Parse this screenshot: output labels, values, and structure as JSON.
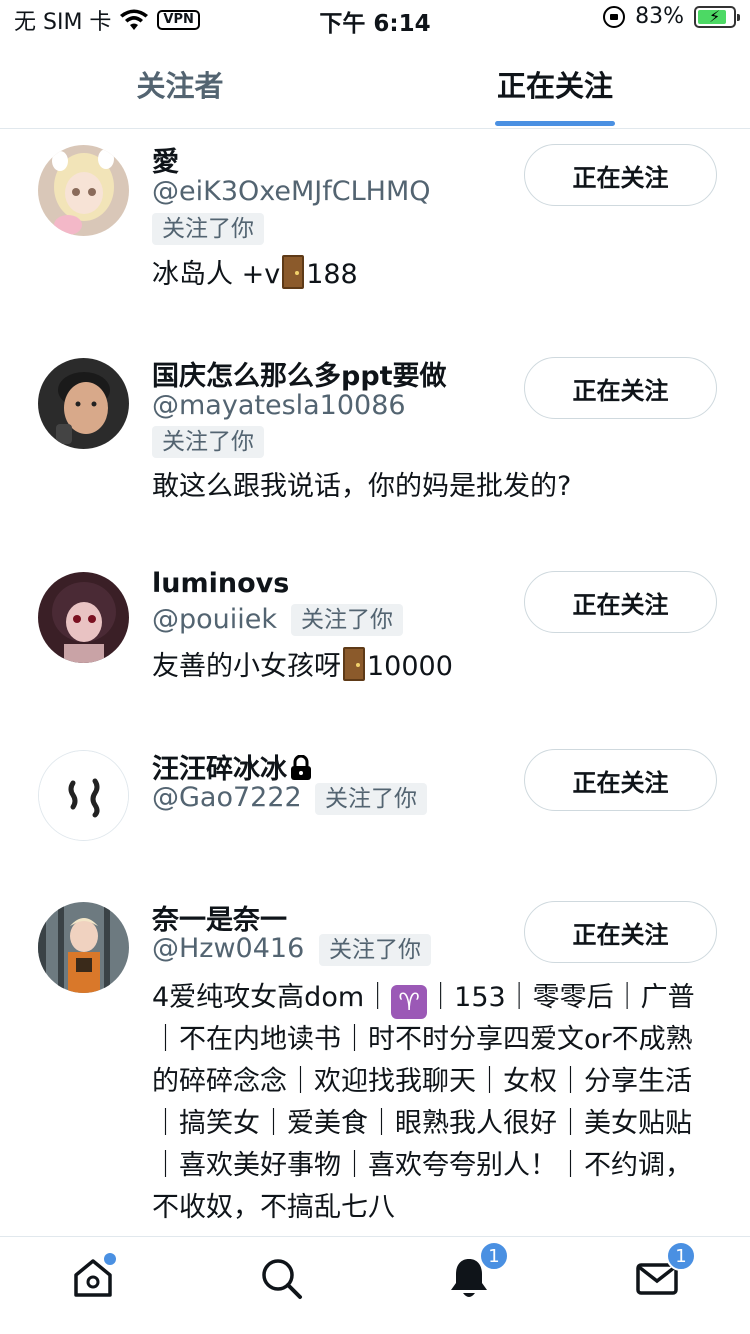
{
  "status_bar": {
    "carrier": "无 SIM 卡",
    "vpn": "VPN",
    "time": "下午 6:14",
    "battery_percent": "83%",
    "battery_level": 0.83
  },
  "tabs": [
    {
      "label": "关注者",
      "selected": false
    },
    {
      "label": "正在关注",
      "selected": true
    }
  ],
  "users": [
    {
      "name": "愛",
      "handle": "@eiK3OxeMJfCLHMQ",
      "follows_you": "关注了你",
      "bio_before": "冰岛人 +v",
      "bio_after": "188",
      "button": "正在关注"
    },
    {
      "name": "国庆怎么那么多ppt要做",
      "handle": "@mayatesla10086",
      "follows_you": "关注了你",
      "bio": "敢这么跟我说话，你的妈是批发的?",
      "button": "正在关注"
    },
    {
      "name": "luminovs",
      "handle": "@pouiiek",
      "follows_you": "关注了你",
      "bio_before": "友善的小女孩呀",
      "bio_after": "10000",
      "button": "正在关注"
    },
    {
      "name": "汪汪碎冰冰",
      "handle": "@Gao7222",
      "follows_you": "关注了你",
      "button": "正在关注"
    },
    {
      "name": "奈一是奈一",
      "handle": "@Hzw0416",
      "follows_you": "关注了你",
      "bio_before": "4爱纯攻女高dom｜",
      "bio_after": "｜153｜零零后｜广普｜不在内地读书｜时不时分享四爱文or不成熟的碎碎念念｜欢迎找我聊天｜女权｜分享生活｜搞笑女｜爱美食｜眼熟我人很好｜美女贴贴｜喜欢美好事物｜喜欢夸夸别人！｜不约调，不收奴，不搞乱七八",
      "button": "正在关注"
    }
  ],
  "bottom_nav": {
    "notifications_count": "1",
    "messages_count": "1"
  },
  "colors": {
    "accent": "#4a90e2",
    "text": "#0f1419",
    "muted": "#536471"
  }
}
